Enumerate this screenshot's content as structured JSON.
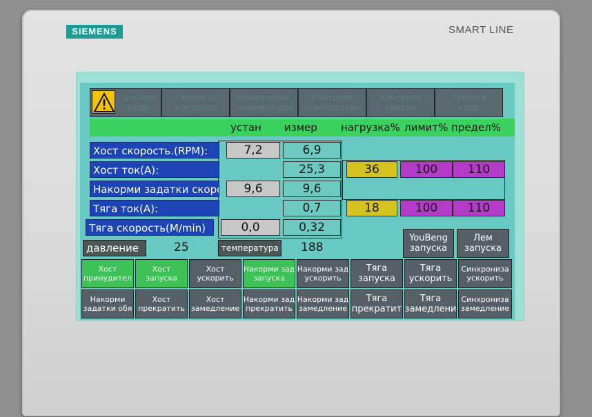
{
  "device": {
    "brand": "SIEMENS",
    "model": "SMART LINE"
  },
  "nav": [
    {
      "line1": "альная",
      "line2": "кадр"
    },
    {
      "line1": "Скорость",
      "line2": "контролл"
    },
    {
      "line1": "Мониторинг",
      "line2": "температуры"
    },
    {
      "line1": "Контроля",
      "line2": "температуры"
    },
    {
      "line1": "Контроля",
      "line2": "кривая"
    },
    {
      "line1": "Тревога",
      "line2": "кадр"
    }
  ],
  "headers": {
    "set": "устан",
    "measured": "измер",
    "load": "нагрузка%",
    "limit": "лимит%",
    "max": "предел%"
  },
  "rows": [
    {
      "label": "Хост скорость.(RPM):",
      "set": "7,2",
      "measured": "6,9"
    },
    {
      "label": "Хост ток(A):",
      "set": "",
      "measured": "25,3",
      "load": "36",
      "limit": "100",
      "max": "110"
    },
    {
      "label": "Накорми задатки скорость",
      "set": "9,6",
      "measured": "9,6"
    },
    {
      "label": "Тяга ток(A):",
      "set": "",
      "measured": "0,7",
      "load": "18",
      "limit": "100",
      "max": "110"
    },
    {
      "label": "Тяга скорость(M/min)",
      "set": "0,0",
      "measured": "0,32"
    }
  ],
  "pressure": {
    "label": "давление",
    "value": "25"
  },
  "temperature": {
    "label": "температура",
    "value": "188"
  },
  "side_buttons": [
    {
      "line1": "YouBeng",
      "line2": "запуска"
    },
    {
      "line1": "Лем",
      "line2": "запуска"
    }
  ],
  "row1_buttons": [
    {
      "line1": "Хост",
      "line2": "принудител"
    },
    {
      "line1": "Хост",
      "line2": "запуска"
    },
    {
      "line1": "Хост",
      "line2": "ускорить"
    },
    {
      "line1": "Накорми зад",
      "line2": "запуска"
    },
    {
      "line1": "Накорми зад",
      "line2": "ускорить"
    },
    {
      "line1": "Тяга",
      "line2": "запуска"
    },
    {
      "line1": "Тяга",
      "line2": "ускорить"
    },
    {
      "line1": "Синхрониза",
      "line2": "ускорить"
    }
  ],
  "row2_buttons": [
    {
      "line1": "Накорми",
      "line2": "задатки обя"
    },
    {
      "line1": "Хост",
      "line2": "прекратить"
    },
    {
      "line1": "Хост",
      "line2": "замедление"
    },
    {
      "line1": "Накорми зад",
      "line2": "прекратить"
    },
    {
      "line1": "Накорми зад",
      "line2": "замедление"
    },
    {
      "line1": "Тяга",
      "line2": "прекратит"
    },
    {
      "line1": "Тяга",
      "line2": "замедлени"
    },
    {
      "line1": "Синхрониза",
      "line2": "замедление"
    }
  ],
  "icons": {
    "warning": "warning-triangle-icon"
  },
  "colors": {
    "screen_bg": "#67c9c1",
    "header_green": "#3bd15f",
    "label_blue": "#1d44b5",
    "load_yellow": "#d4c31e",
    "limit_purple": "#b43bc8",
    "button_grey": "#556066",
    "active_green": "#3ec258",
    "brand_teal": "#1e9c94"
  }
}
